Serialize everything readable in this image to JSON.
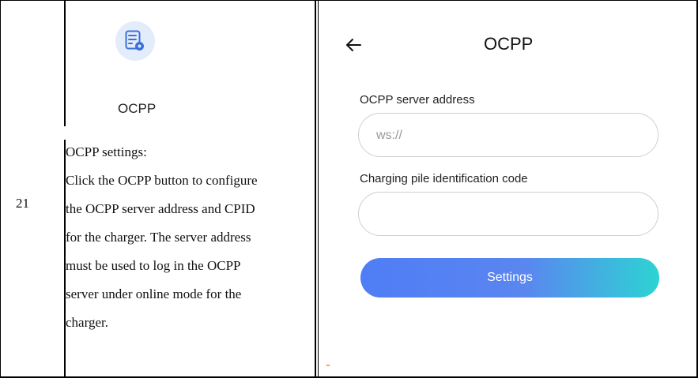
{
  "row": {
    "number": "21",
    "icon_name": "document-settings-icon",
    "icon_label": "OCPP",
    "description_lines": [
      "OCPP settings:",
      "Click the OCPP button to configure",
      "the OCPP server address and CPID",
      "for the charger. The server address",
      "must be used to log in the OCPP",
      "server under online mode for the",
      "charger."
    ]
  },
  "screen": {
    "title": "OCPP",
    "back_icon": "back-arrow-icon",
    "server_address_label": "OCPP server address",
    "server_address_placeholder": "ws://",
    "pile_code_label": "Charging pile identification code",
    "pile_code_placeholder": "",
    "settings_button": "Settings"
  },
  "colors": {
    "accent_start": "#4f7df5",
    "accent_end": "#2dd3d3",
    "icon_bg": "#e3ecfb",
    "icon_stroke": "#3d6fd8"
  }
}
